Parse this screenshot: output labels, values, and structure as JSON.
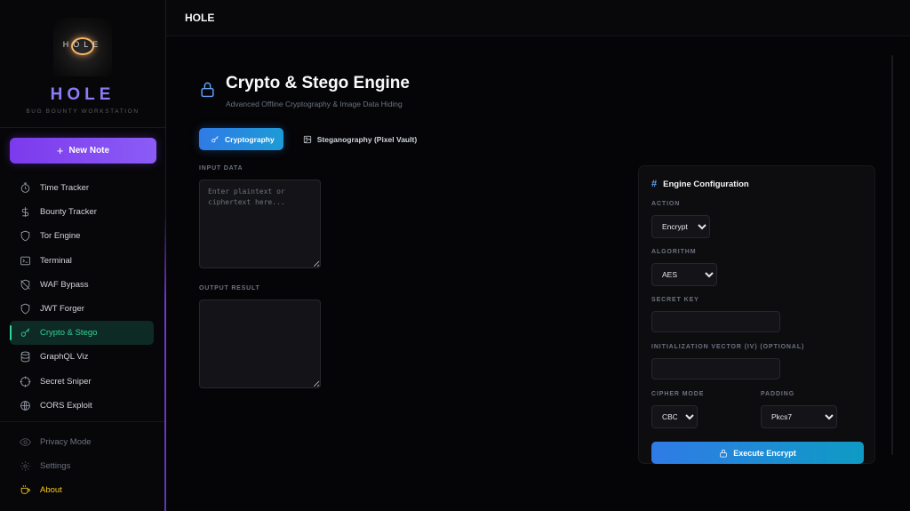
{
  "app": {
    "logo_text": "HOLE",
    "brand": "HOLE",
    "brand_sub": "BUG BOUNTY WORKSTATION",
    "top_title": "HOLE"
  },
  "sidebar": {
    "new_note_label": "New Note",
    "items": [
      {
        "label": "Time Tracker",
        "icon": "stopwatch-icon"
      },
      {
        "label": "Bounty Tracker",
        "icon": "dollar-icon"
      },
      {
        "label": "Tor Engine",
        "icon": "shield-icon"
      },
      {
        "label": "Terminal",
        "icon": "terminal-icon"
      },
      {
        "label": "WAF Bypass",
        "icon": "shield-off-icon"
      },
      {
        "label": "JWT Forger",
        "icon": "shield-icon"
      },
      {
        "label": "Crypto & Stego",
        "icon": "key-icon",
        "active": true
      },
      {
        "label": "GraphQL Viz",
        "icon": "database-icon"
      },
      {
        "label": "Secret Sniper",
        "icon": "crosshair-icon"
      },
      {
        "label": "CORS Exploit",
        "icon": "globe-icon"
      }
    ],
    "bottom": [
      {
        "label": "Privacy Mode",
        "icon": "eye-icon"
      },
      {
        "label": "Settings",
        "icon": "gear-icon"
      },
      {
        "label": "About",
        "icon": "coffee-icon"
      }
    ]
  },
  "page": {
    "title": "Crypto & Stego Engine",
    "subtitle": "Advanced Offline Cryptography & Image Data Hiding",
    "tabs": [
      {
        "label": "Cryptography",
        "active": true
      },
      {
        "label": "Steganography (Pixel Vault)",
        "active": false
      }
    ],
    "input_label": "INPUT DATA",
    "input_placeholder": "Enter plaintext or ciphertext here...",
    "input_value": "",
    "output_label": "OUTPUT RESULT",
    "output_value": ""
  },
  "config": {
    "title": "Engine Configuration",
    "action_label": "ACTION",
    "action_value": "Encrypt",
    "algorithm_label": "ALGORITHM",
    "algorithm_value": "AES",
    "secret_key_label": "SECRET KEY",
    "secret_key_value": "",
    "iv_label": "INITIALIZATION VECTOR (IV) (OPTIONAL)",
    "iv_value": "",
    "cipher_mode_label": "CIPHER MODE",
    "cipher_mode_value": "CBC",
    "padding_label": "PADDING",
    "padding_value": "Pkcs7",
    "execute_label": "Execute Encrypt"
  },
  "colors": {
    "accent_purple": "#7c3aed",
    "accent_blue": "#2f7be6",
    "active_green": "#34d399",
    "about_yellow": "#facc15"
  }
}
